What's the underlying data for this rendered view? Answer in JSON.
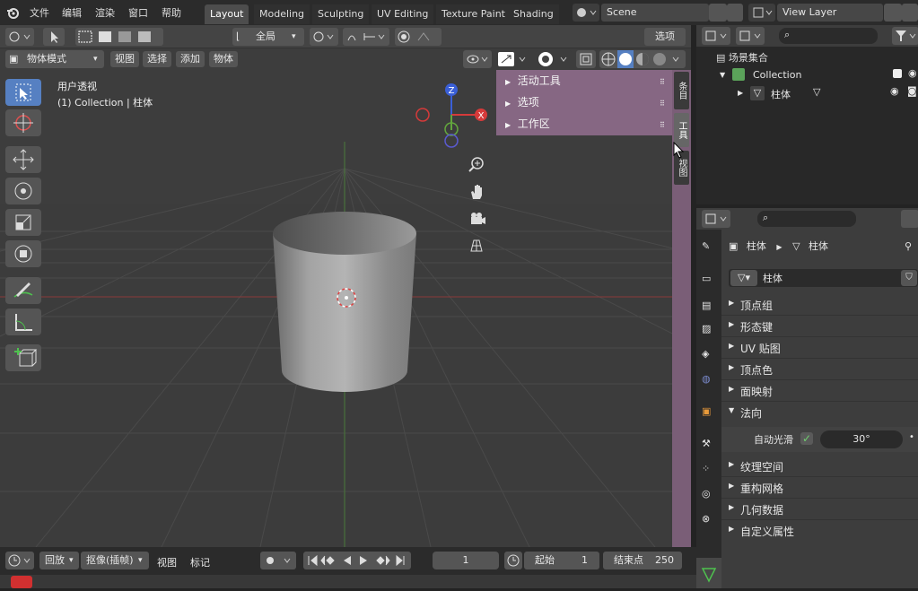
{
  "menu": {
    "file": "文件",
    "edit": "编辑",
    "render": "渲染",
    "window": "窗口",
    "help": "帮助"
  },
  "workspaces": [
    "Layout",
    "Modeling",
    "Sculpting",
    "UV Editing",
    "Texture Paint",
    "Shading"
  ],
  "scene": {
    "name": "Scene",
    "view_layer": "View Layer"
  },
  "viewport_header": {
    "transform_orientation": "全局",
    "options": "选项"
  },
  "viewport_header2": {
    "mode": "物体模式",
    "view": "视图",
    "select": "选择",
    "add": "添加",
    "object": "物体"
  },
  "viewport_info": {
    "line1": "用户透视",
    "line2": "(1) Collection | 柱体"
  },
  "gizmo": {
    "z": "Z",
    "x": "X"
  },
  "npanel": {
    "active_tool": "活动工具",
    "options": "选项",
    "workspace": "工作区"
  },
  "sidebar_tabs": {
    "item": "条目",
    "tool": "工具",
    "view": "视图"
  },
  "outliner": {
    "scene_collection": "场景集合",
    "collection": "Collection",
    "object": "柱体"
  },
  "properties": {
    "breadcrumb_object": "柱体",
    "breadcrumb_mesh": "柱体",
    "datablock": "柱体",
    "panels": [
      {
        "label": "顶点组",
        "expanded": false
      },
      {
        "label": "形态键",
        "expanded": false
      },
      {
        "label": "UV 贴图",
        "expanded": false
      },
      {
        "label": "顶点色",
        "expanded": false
      },
      {
        "label": "面映射",
        "expanded": false
      },
      {
        "label": "法向",
        "expanded": true
      }
    ],
    "auto_smooth_label": "自动光滑",
    "auto_smooth_angle": "30°",
    "auto_smooth_checked": true,
    "panels2": [
      {
        "label": "纹理空间"
      },
      {
        "label": "重构网格"
      },
      {
        "label": "几何数据"
      },
      {
        "label": "自定义属性"
      }
    ]
  },
  "timeline": {
    "playback": "回放",
    "keying": "抠像(插帧)",
    "view": "视图",
    "marker": "标记",
    "current_frame": "1",
    "start_label": "起始",
    "start": "1",
    "end_label": "结束点",
    "end": "250"
  },
  "colors": {
    "accent_blue": "#5680c2",
    "npanel": "#8a6a87",
    "x_axis": "#d63a3a",
    "y_axis": "#63a73d",
    "z_axis": "#3a5fd6",
    "collection_green": "#5ba35a"
  }
}
